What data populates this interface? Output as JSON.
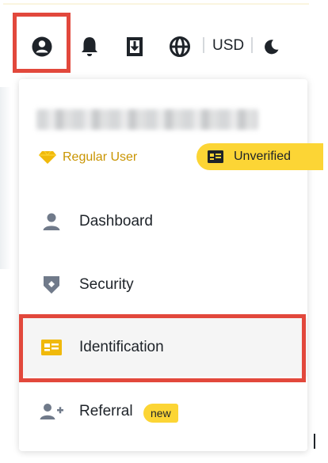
{
  "header": {
    "currency_label": "USD",
    "icons": {
      "profile": "user-circle-icon",
      "notifications": "bell-icon",
      "download": "download-icon",
      "language": "globe-icon",
      "theme": "moon-icon"
    }
  },
  "account_menu": {
    "user_level": "Regular User",
    "verification_status": "Unverified",
    "items": [
      {
        "label": "Dashboard",
        "icon": "user-icon"
      },
      {
        "label": "Security",
        "icon": "shield-icon"
      },
      {
        "label": "Identification",
        "icon": "id-card-icon",
        "active": true
      },
      {
        "label": "Referral",
        "icon": "add-user-icon",
        "badge": "new"
      }
    ]
  },
  "colors": {
    "accent_yellow": "#fcd535",
    "gold_text": "#c99400",
    "highlight_red": "#e2483c",
    "text_primary": "#1e2329",
    "icon_gray": "#707a8a"
  }
}
